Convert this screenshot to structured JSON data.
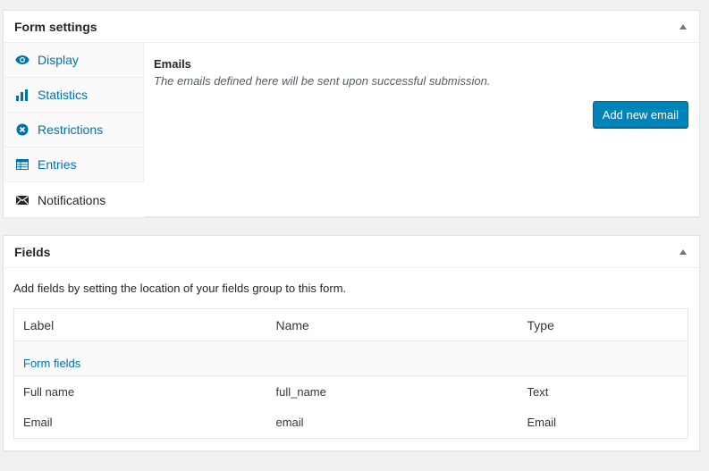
{
  "settings_box": {
    "title": "Form settings",
    "tabs": [
      {
        "label": "Display",
        "icon": "eye-icon"
      },
      {
        "label": "Statistics",
        "icon": "bar-chart-icon"
      },
      {
        "label": "Restrictions",
        "icon": "restriction-icon"
      },
      {
        "label": "Entries",
        "icon": "table-icon"
      },
      {
        "label": "Notifications",
        "icon": "envelope-icon"
      }
    ],
    "active_tab": "Notifications",
    "panel": {
      "heading": "Emails",
      "description": "The emails defined here will be sent upon successful submission.",
      "add_button": "Add new email"
    }
  },
  "fields_box": {
    "title": "Fields",
    "description": "Add fields by setting the location of your fields group to this form.",
    "table": {
      "headers": [
        "Label",
        "Name",
        "Type"
      ],
      "group_label": "Form fields",
      "rows": [
        {
          "label": "Full name",
          "name": "full_name",
          "type": "Text"
        },
        {
          "label": "Email",
          "name": "email",
          "type": "Email"
        }
      ]
    }
  },
  "colors": {
    "link": "#0073aa",
    "button": "#0085ba",
    "background": "#f1f1f1"
  }
}
